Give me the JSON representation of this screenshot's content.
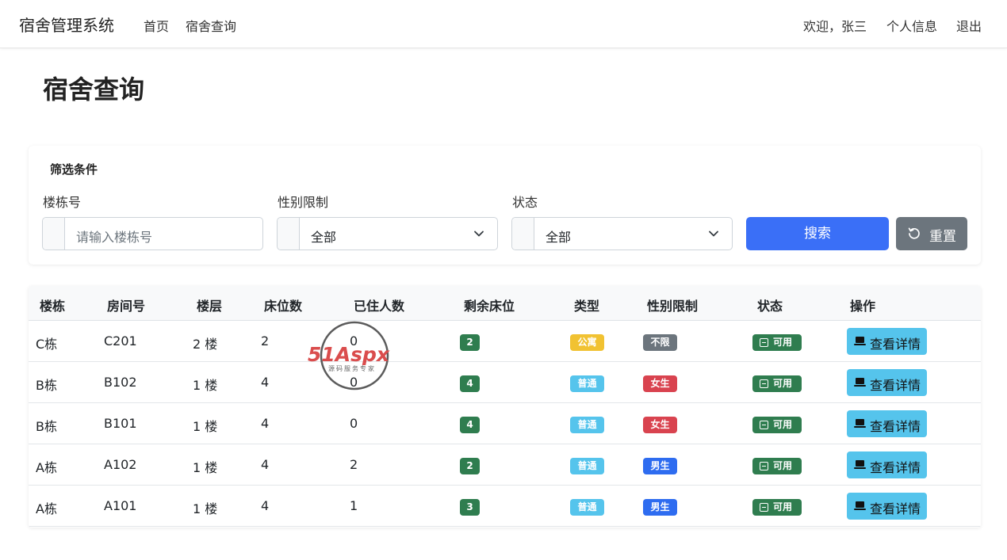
{
  "nav": {
    "brand": "宿舍管理系统",
    "links": [
      "首页",
      "宿舍查询"
    ],
    "welcome": "欢迎，张三",
    "profile": "个人信息",
    "logout": "退出"
  },
  "page": {
    "title": "宿舍查询"
  },
  "filter": {
    "title": "筛选条件",
    "building": {
      "label": "楼栋号",
      "placeholder": "请输入楼栋号"
    },
    "gender": {
      "label": "性别限制",
      "value": "全部"
    },
    "status": {
      "label": "状态",
      "value": "全部"
    },
    "search_label": "搜索",
    "reset_label": "重置"
  },
  "table": {
    "headers": [
      "楼栋",
      "房间号",
      "楼层",
      "床位数",
      "已住人数",
      "剩余床位",
      "类型",
      "性别限制",
      "状态",
      "操作"
    ],
    "rows": [
      {
        "building": "C栋",
        "room": "C201",
        "floor": "2 楼",
        "beds": "2",
        "occupied": "0",
        "remaining": "2",
        "type": "公寓",
        "gender": "不限",
        "status": "可用",
        "action": "查看详情"
      },
      {
        "building": "B栋",
        "room": "B102",
        "floor": "1 楼",
        "beds": "4",
        "occupied": "0",
        "remaining": "4",
        "type": "普通",
        "gender": "女生",
        "status": "可用",
        "action": "查看详情"
      },
      {
        "building": "B栋",
        "room": "B101",
        "floor": "1 楼",
        "beds": "4",
        "occupied": "0",
        "remaining": "4",
        "type": "普通",
        "gender": "女生",
        "status": "可用",
        "action": "查看详情"
      },
      {
        "building": "A栋",
        "room": "A102",
        "floor": "1 楼",
        "beds": "4",
        "occupied": "2",
        "remaining": "2",
        "type": "普通",
        "gender": "男生",
        "status": "可用",
        "action": "查看详情"
      },
      {
        "building": "A栋",
        "room": "A101",
        "floor": "1 楼",
        "beds": "4",
        "occupied": "1",
        "remaining": "3",
        "type": "普通",
        "gender": "男生",
        "status": "可用",
        "action": "查看详情"
      }
    ]
  },
  "watermark": {
    "logo": "51Aspx",
    "tagline": "源码服务专家"
  },
  "colors": {
    "primary": "#3a6ff7",
    "secondary": "#6c757d",
    "success": "#2f7d4f",
    "info": "#55c4ec",
    "warning": "#f1c232",
    "danger": "#d9434f"
  },
  "icons": [
    "chevron-down-icon",
    "reset-icon",
    "minus-square-icon",
    "laptop-icon"
  ]
}
